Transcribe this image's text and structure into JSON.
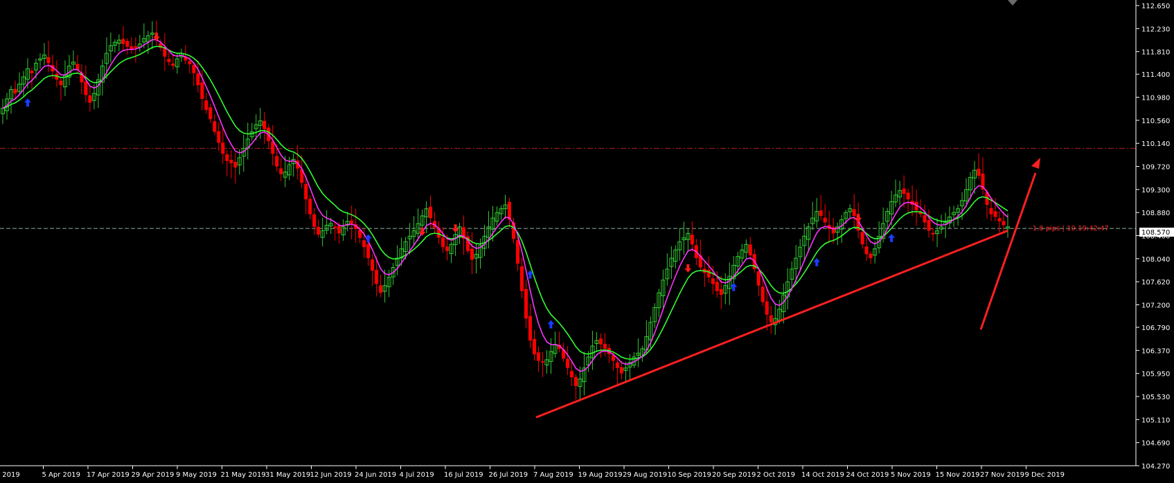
{
  "corner_label": "70",
  "current_price_label": "108.570",
  "pips_label": "-1.8 pips | 10.19:42:47",
  "colors": {
    "background": "#000000",
    "bull_candle": "#33cc33",
    "bear_candle": "#ff0000",
    "ma_fast": "#ff33ff",
    "ma_slow": "#33ff33",
    "trendline": "#ff2020",
    "resistance_line": "#b32424",
    "bid_line": "#8fb0a0",
    "up_arrow": "#1a3cff",
    "down_arrow": "#ff1a1a"
  },
  "chart_data": {
    "type": "candlestick",
    "y_ticks": [
      "112.650",
      "112.230",
      "111.810",
      "111.400",
      "110.980",
      "110.560",
      "110.140",
      "109.720",
      "109.300",
      "108.880",
      "108.460",
      "108.040",
      "107.620",
      "107.200",
      "106.790",
      "106.370",
      "105.950",
      "105.530",
      "105.110",
      "104.690",
      "104.270"
    ],
    "ylim": [
      104.27,
      112.65
    ],
    "x_labels": [
      "r 2019",
      "5 Apr 2019",
      "17 Apr 2019",
      "29 Apr 2019",
      "9 May 2019",
      "21 May 2019",
      "31 May 2019",
      "12 Jun 2019",
      "24 Jun 2019",
      "4 Jul 2019",
      "16 Jul 2019",
      "26 Jul 2019",
      "7 Aug 2019",
      "19 Aug 2019",
      "29 Aug 2019",
      "10 Sep 2019",
      "20 Sep 2019",
      "2 Oct 2019",
      "14 Oct 2019",
      "24 Oct 2019",
      "5 Nov 2019",
      "15 Nov 2019",
      "27 Nov 2019",
      "9 Dec 2019"
    ],
    "closes": [
      110.78,
      110.95,
      111.12,
      111.05,
      111.22,
      111.35,
      111.5,
      111.42,
      111.6,
      111.68,
      111.75,
      111.6,
      111.45,
      111.3,
      111.2,
      111.38,
      111.55,
      111.62,
      111.48,
      111.25,
      111.02,
      110.88,
      111.05,
      111.3,
      111.55,
      111.78,
      111.92,
      111.98,
      112.02,
      111.95,
      111.9,
      111.85,
      111.88,
      111.95,
      112.05,
      112.1,
      112.15,
      112.02,
      111.88,
      111.72,
      111.62,
      111.55,
      111.68,
      111.78,
      111.65,
      111.58,
      111.42,
      111.2,
      110.95,
      110.75,
      110.58,
      110.35,
      110.15,
      109.95,
      109.82,
      109.78,
      109.7,
      109.88,
      110.05,
      110.22,
      110.35,
      110.48,
      110.55,
      110.4,
      110.18,
      109.95,
      109.72,
      109.58,
      109.62,
      109.75,
      109.85,
      109.68,
      109.42,
      109.12,
      108.85,
      108.62,
      108.48,
      108.55,
      108.65,
      108.68,
      108.6,
      108.5,
      108.62,
      108.72,
      108.68,
      108.58,
      108.42,
      108.25,
      108.05,
      107.82,
      107.58,
      107.42,
      107.55,
      107.7,
      107.88,
      108.05,
      108.22,
      108.35,
      108.45,
      108.55,
      108.68,
      108.82,
      108.95,
      108.78,
      108.6,
      108.42,
      108.25,
      108.18,
      108.3,
      108.48,
      108.62,
      108.4,
      108.18,
      108.02,
      108.12,
      108.28,
      108.45,
      108.62,
      108.78,
      108.88,
      108.95,
      109.02,
      108.75,
      108.4,
      107.95,
      107.45,
      106.95,
      106.55,
      106.3,
      106.18,
      106.15,
      106.2,
      106.35,
      106.48,
      106.4,
      106.22,
      106.05,
      105.88,
      105.72,
      105.85,
      106.05,
      106.25,
      106.45,
      106.55,
      106.48,
      106.4,
      106.3,
      106.18,
      106.05,
      105.95,
      106.05,
      106.15,
      106.25,
      106.32,
      106.4,
      106.62,
      106.88,
      107.15,
      107.42,
      107.65,
      107.85,
      108.05,
      108.2,
      108.35,
      108.42,
      108.5,
      108.3,
      108.05,
      107.88,
      107.78,
      107.7,
      107.58,
      107.45,
      107.38,
      107.55,
      107.72,
      107.92,
      108.08,
      108.2,
      108.3,
      108.1,
      107.85,
      107.55,
      107.25,
      107.02,
      106.88,
      106.95,
      107.12,
      107.38,
      107.62,
      107.85,
      108.05,
      108.25,
      108.45,
      108.62,
      108.78,
      108.9,
      108.82,
      108.7,
      108.58,
      108.5,
      108.62,
      108.75,
      108.88,
      108.95,
      108.82,
      108.55,
      108.3,
      108.12,
      108.05,
      108.22,
      108.45,
      108.68,
      108.9,
      109.08,
      109.2,
      109.28,
      109.22,
      109.12,
      109.02,
      108.92,
      108.85,
      108.7,
      108.55,
      108.48,
      108.55,
      108.62,
      108.7,
      108.8,
      108.88,
      108.95,
      109.1,
      109.3,
      109.52,
      109.65,
      109.55,
      109.3,
      109.02,
      108.85,
      108.8,
      108.72,
      108.65,
      108.62
    ]
  },
  "annotations": {
    "up_arrow_count": 8,
    "down_arrow_count": 7,
    "trendline_label": "",
    "projection_arrow": true
  }
}
